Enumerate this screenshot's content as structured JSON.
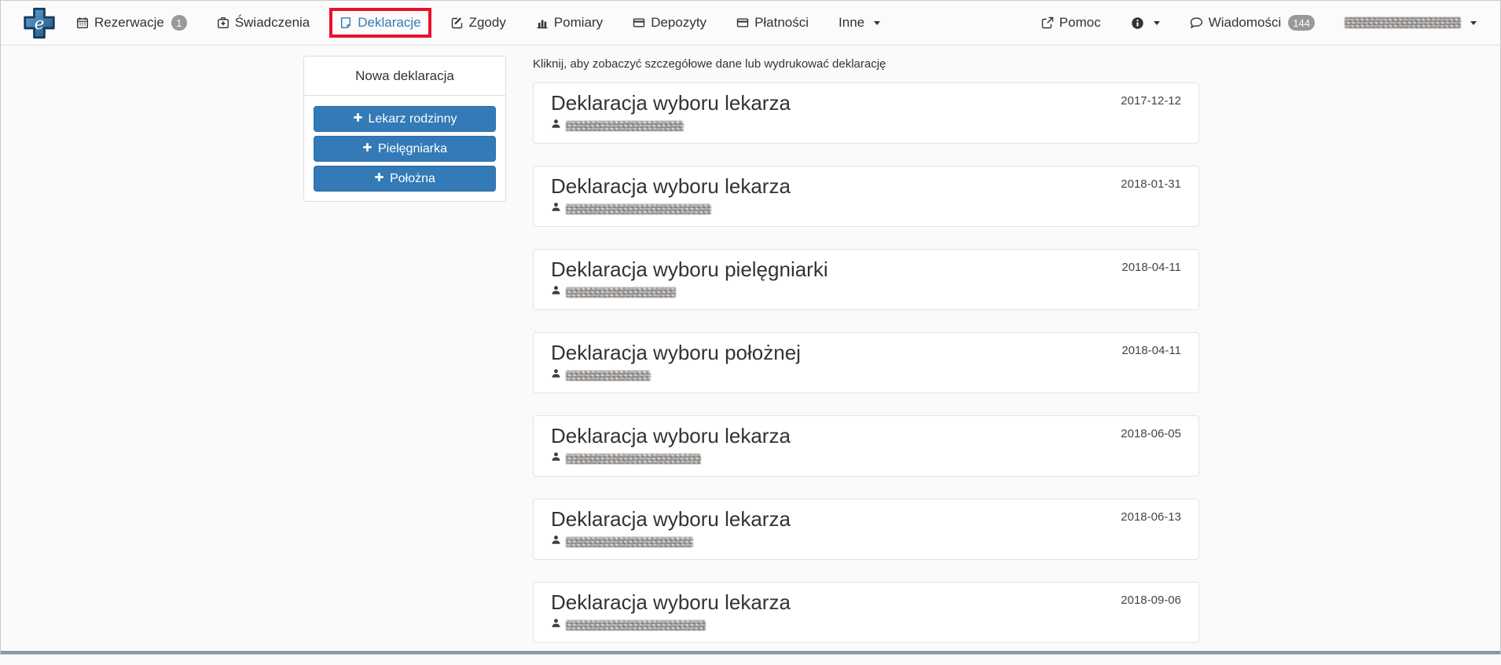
{
  "colors": {
    "accent_blue": "#337ab7",
    "highlight_red": "#e8112d",
    "badge_gray": "#999999",
    "card_border": "#e3e3e3",
    "page_background": "#fafafa",
    "bottom_bar": "#8497ae"
  },
  "navbar": {
    "logo": {
      "letter": "e",
      "icon": "e-health-cross-logo"
    },
    "items": [
      {
        "label": "Rezerwacje",
        "icon": "calendar-icon",
        "badge": "1",
        "active": false
      },
      {
        "label": "Świadczenia",
        "icon": "medical-bag-icon",
        "active": false
      },
      {
        "label": "Deklaracje",
        "icon": "file-icon",
        "active": true,
        "highlighted": true
      },
      {
        "label": "Zgody",
        "icon": "pencil-square-icon",
        "active": false
      },
      {
        "label": "Pomiary",
        "icon": "bar-chart-icon",
        "active": false
      },
      {
        "label": "Depozyty",
        "icon": "credit-card-icon",
        "active": false
      },
      {
        "label": "Płatności",
        "icon": "credit-card-icon",
        "active": false
      },
      {
        "label": "Inne",
        "icon": "caret-down-icon",
        "active": false,
        "dropdown": true
      }
    ],
    "right": {
      "help_label": "Pomoc",
      "help_icon": "external-link-icon",
      "info_icon": "info-circle-icon",
      "messages_label": "Wiadomości",
      "messages_icon": "chat-icon",
      "messages_badge": "144",
      "user_name_redacted": true
    }
  },
  "sidebar": {
    "title": "Nowa deklaracja",
    "buttons": [
      {
        "label": "Lekarz rodzinny",
        "icon": "plus-icon"
      },
      {
        "label": "Pielęgniarka",
        "icon": "plus-icon"
      },
      {
        "label": "Położna",
        "icon": "plus-icon"
      }
    ]
  },
  "main": {
    "instruction": "Kliknij, aby zobaczyć szczegółowe dane lub wydrukować deklarację",
    "declarations": [
      {
        "title": "Deklaracja wyboru lekarza",
        "date": "2017-12-12",
        "person_redacted": true
      },
      {
        "title": "Deklaracja wyboru lekarza",
        "date": "2018-01-31",
        "person_redacted": true
      },
      {
        "title": "Deklaracja wyboru pielęgniarki",
        "date": "2018-04-11",
        "person_redacted": true
      },
      {
        "title": "Deklaracja wyboru położnej",
        "date": "2018-04-11",
        "person_redacted": true
      },
      {
        "title": "Deklaracja wyboru lekarza",
        "date": "2018-06-05",
        "person_redacted": true
      },
      {
        "title": "Deklaracja wyboru lekarza",
        "date": "2018-06-13",
        "person_redacted": true
      },
      {
        "title": "Deklaracja wyboru lekarza",
        "date": "2018-09-06",
        "person_redacted": true
      }
    ]
  }
}
